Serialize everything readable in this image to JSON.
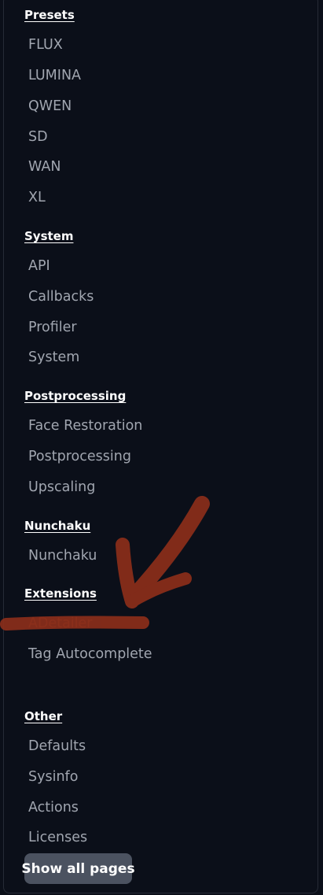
{
  "sections": [
    {
      "title": "Presets",
      "items": [
        "FLUX",
        "LUMINA",
        "QWEN",
        "SD",
        "WAN",
        "XL"
      ]
    },
    {
      "title": "System",
      "items": [
        "API",
        "Callbacks",
        "Profiler",
        "System"
      ]
    },
    {
      "title": "Postprocessing",
      "items": [
        "Face Restoration",
        "Postprocessing",
        "Upscaling"
      ]
    },
    {
      "title": "Nunchaku",
      "items": [
        "Nunchaku"
      ]
    },
    {
      "title": "Extensions",
      "items": [
        "ADetailer",
        "Tag Autocomplete"
      ]
    },
    {
      "title": "Other",
      "items": [
        "Defaults",
        "Sysinfo",
        "Actions",
        "Licenses"
      ]
    }
  ],
  "show_all_label": "Show all pages",
  "colors": {
    "background": "#0b0f19",
    "item_text": "#a1a6b0",
    "heading_text": "#ffffff",
    "annotation": "#8b2e1a",
    "button_bg": "#4b5260"
  }
}
